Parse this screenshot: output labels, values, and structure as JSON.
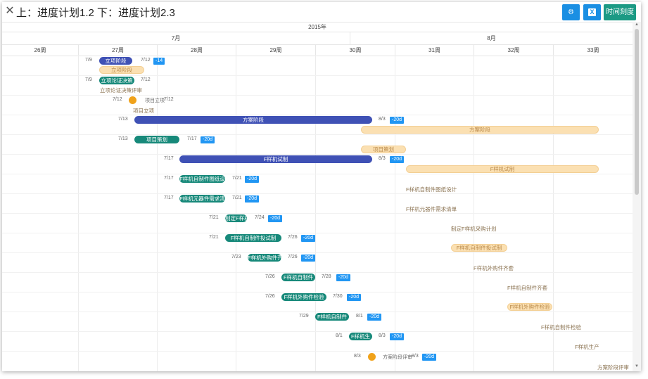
{
  "window": {
    "title": "上：进度计划1.2 下：进度计划2.3",
    "close_icon": "close-icon",
    "buttons": {
      "settings_icon": "gear-icon",
      "excel_label": "X",
      "timescale_label": "时间刻度"
    }
  },
  "timeline": {
    "year": "2015年",
    "months": [
      "7月",
      "8月"
    ],
    "weeks": [
      "26周",
      "27周",
      "28周",
      "29周",
      "30周",
      "31周",
      "32周",
      "33周"
    ]
  },
  "tasks": [
    {
      "bar": "立项阶段",
      "start": "7/9",
      "end": "7/12",
      "delta": "-14",
      "plan_label": "立项阶段"
    },
    {
      "bar": "立项论证决策",
      "start": "7/9",
      "end": "7/12",
      "plan_label": "立项论证决策评审"
    },
    {
      "start": "7/12",
      "milestone_label": "项目立项",
      "end": "7/12",
      "plan_label": "项目立项"
    },
    {
      "bar": "方案阶段",
      "start": "7/13",
      "end": "8/3",
      "delta": "-20d",
      "plan_label": "方案阶段"
    },
    {
      "bar": "项目策划",
      "start": "7/13",
      "end": "7/17",
      "delta": "-20d",
      "plan_label": "项目策划"
    },
    {
      "bar": "F样机试制",
      "start": "7/17",
      "end": "8/3",
      "delta": "-20d",
      "plan_label": "F样机试制"
    },
    {
      "bar": "F样机自制件图纸设",
      "start": "7/17",
      "end": "7/21",
      "delta": "-20d",
      "plan_label": "F样机自制件图纸设计"
    },
    {
      "bar": "F样机元器件需求清",
      "start": "7/17",
      "end": "7/21",
      "delta": "-20d",
      "plan_label": "F样机元器件需求清单"
    },
    {
      "bar": "制定F样机",
      "start": "7/21",
      "end": "7/24",
      "delta": "-20d",
      "plan_label": "制定F样机采购计划"
    },
    {
      "bar": "F样机自制件投试制",
      "start": "7/21",
      "end": "7/26",
      "delta": "-20d",
      "plan_label": "F样机自制件投试制"
    },
    {
      "bar": "F样机外购件齐",
      "start": "7/23",
      "end": "7/26",
      "delta": "-20d",
      "plan_label": "F样机外购件齐套"
    },
    {
      "bar": "F样机自制件",
      "start": "7/26",
      "end": "7/28",
      "delta": "-20d",
      "plan_label": "F样机自制件齐套"
    },
    {
      "bar": "F样机外购件检验",
      "start": "7/26",
      "end": "7/30",
      "delta": "-20d",
      "plan_label": "F样机外购件检验"
    },
    {
      "bar": "F样机自制件",
      "start": "7/29",
      "end": "8/1",
      "delta": "-20d",
      "plan_label": "F样机自制件检验"
    },
    {
      "bar": "F样机生",
      "start": "8/1",
      "end": "8/3",
      "delta": "-20d",
      "plan_label": "F样机生产"
    },
    {
      "start": "8/3",
      "milestone_label": "方案阶段评审",
      "end": "8/3",
      "delta": "-20d",
      "plan_label": "方案阶段评审"
    }
  ],
  "colors": {
    "actual_phase": "#3f51b5",
    "actual_task": "#17897a",
    "plan": "#fbe0b2",
    "milestone": "#f0a21a",
    "delta_badge": "#2196f3"
  }
}
